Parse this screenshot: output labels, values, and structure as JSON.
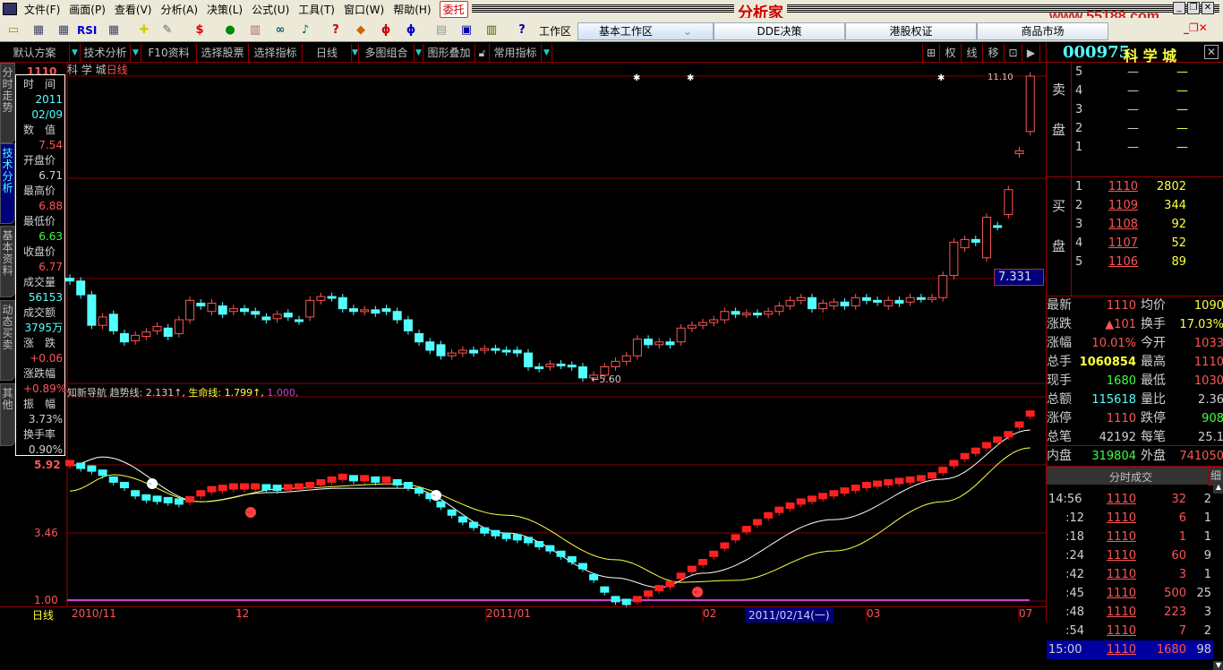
{
  "menu": {
    "items": [
      "文件(F)",
      "画面(P)",
      "查看(V)",
      "分析(A)",
      "决策(L)",
      "公式(U)",
      "工具(T)",
      "窗口(W)",
      "帮助(H)"
    ],
    "entrust": "委托",
    "title": "分析家",
    "logo": "www.55188.com"
  },
  "toolbar": {
    "workspace_label": "工作区",
    "tabs": [
      "基本工作区",
      "DDE决策",
      "港股权证",
      "商品市场"
    ],
    "rsi": "RSI"
  },
  "funcbar": {
    "buttons": [
      "默认方案",
      "技术分析",
      "F10资料",
      "选择股票",
      "选择指标",
      "日线",
      "多图组合",
      "图形叠加",
      "常用指标"
    ],
    "right": [
      "权",
      "线",
      "移"
    ]
  },
  "side_tabs": [
    "分时走势",
    "技术分析",
    "基本资料",
    "动态买卖",
    "其他"
  ],
  "chart_header": {
    "name": "科 学 城",
    "period": "日线",
    "top_price": "1110",
    "max_label": "11.10",
    "min_label": "5.60",
    "current_value": "7.331"
  },
  "info": [
    [
      "时　间",
      "2011"
    ],
    [
      "",
      "02/09"
    ],
    [
      "数　值",
      "7.54"
    ],
    [
      "开盘价",
      "6.71"
    ],
    [
      "最高价",
      "6.88"
    ],
    [
      "最低价",
      "6.63"
    ],
    [
      "收盘价",
      "6.77"
    ],
    [
      "成交量",
      "56153"
    ],
    [
      "成交额",
      "3795万"
    ],
    [
      "涨　跌",
      "+0.06"
    ],
    [
      "涨跌幅",
      "+0.89%"
    ],
    [
      "振　幅",
      "3.73%"
    ],
    [
      "换手率",
      "0.90%"
    ]
  ],
  "indicator": {
    "name": "知新导航",
    "trend_label": "趋势线: 2.131↑,",
    "life_label": "生命线: 1.799↑,",
    "base_label": "1.000,",
    "ticks": [
      "5.92",
      "3.46",
      "1.00"
    ]
  },
  "date_axis": {
    "period": "日线",
    "labels": [
      "2010/11",
      "12",
      "2011/01",
      "02",
      "03",
      "07"
    ],
    "cursor": "2011/02/14(一)"
  },
  "chart_data": {
    "type": "candlestick",
    "price_range": [
      5.6,
      11.1
    ],
    "open": [
      7.45,
      7.4,
      7.15,
      6.6,
      6.8,
      6.45,
      6.32,
      6.4,
      6.5,
      6.55,
      6.45,
      6.7,
      7.0,
      6.85,
      6.95,
      6.85,
      6.9,
      6.85,
      6.75,
      6.72,
      6.82,
      6.7,
      6.75,
      7.05,
      7.12,
      7.1,
      6.9,
      6.85,
      6.88,
      6.9,
      6.85,
      6.7,
      6.45,
      6.3,
      6.25,
      6.05,
      6.1,
      6.15,
      6.15,
      6.18,
      6.15,
      6.15,
      6.1,
      5.85,
      5.85,
      5.9,
      5.88,
      5.85,
      5.65,
      5.7,
      5.85,
      5.95,
      6.05,
      6.35,
      6.25,
      6.3,
      6.3,
      6.55,
      6.6,
      6.65,
      6.7,
      6.85,
      6.8,
      6.82,
      6.8,
      6.85,
      6.95,
      7.05,
      7.1,
      6.9,
      6.95,
      7.02,
      6.95,
      7.1,
      7.05,
      6.95,
      7.05,
      7.02,
      7.1,
      7.08,
      7.1,
      7.5,
      8.0,
      8.15,
      7.82,
      8.4,
      8.6,
      9.7,
      10.1
    ],
    "close": [
      7.4,
      7.15,
      6.6,
      6.75,
      6.5,
      6.3,
      6.42,
      6.48,
      6.58,
      6.4,
      6.7,
      7.05,
      6.95,
      7.0,
      6.8,
      6.9,
      6.85,
      6.8,
      6.7,
      6.8,
      6.75,
      6.68,
      7.05,
      7.12,
      7.1,
      6.9,
      6.85,
      6.88,
      6.82,
      6.85,
      6.7,
      6.5,
      6.3,
      6.15,
      6.05,
      6.1,
      6.15,
      6.1,
      6.18,
      6.15,
      6.12,
      6.1,
      5.85,
      5.82,
      5.9,
      5.88,
      5.85,
      5.65,
      5.7,
      5.85,
      5.95,
      6.05,
      6.35,
      6.25,
      6.3,
      6.25,
      6.55,
      6.6,
      6.65,
      6.7,
      6.85,
      6.8,
      6.82,
      6.8,
      6.85,
      6.95,
      7.05,
      7.1,
      6.9,
      7.0,
      7.02,
      6.95,
      7.1,
      7.05,
      7.02,
      7.05,
      7.0,
      7.1,
      7.08,
      7.1,
      7.5,
      8.1,
      8.15,
      8.1,
      8.55,
      8.38,
      9.05,
      9.75,
      11.1
    ],
    "indicator_values": [
      6.1,
      6.0,
      5.9,
      5.75,
      5.5,
      5.3,
      5.0,
      4.85,
      4.8,
      4.75,
      4.7,
      4.78,
      5.0,
      5.15,
      5.2,
      5.25,
      5.25,
      5.25,
      5.22,
      5.2,
      5.22,
      5.25,
      5.3,
      5.4,
      5.5,
      5.6,
      5.55,
      5.55,
      5.5,
      5.5,
      5.4,
      5.3,
      5.1,
      4.9,
      4.6,
      4.3,
      4.05,
      3.85,
      3.65,
      3.55,
      3.45,
      3.4,
      3.3,
      3.15,
      3.0,
      2.8,
      2.6,
      2.35,
      1.95,
      1.5,
      1.15,
      1.05,
      1.15,
      1.35,
      1.55,
      1.7,
      2.0,
      2.25,
      2.5,
      2.8,
      3.1,
      3.4,
      3.7,
      3.95,
      4.2,
      4.4,
      4.55,
      4.7,
      4.8,
      4.9,
      5.0,
      5.1,
      5.2,
      5.3,
      5.35,
      5.4,
      5.45,
      5.5,
      5.55,
      5.65,
      5.85,
      6.1,
      6.35,
      6.55,
      6.75,
      6.95,
      7.15,
      7.5,
      7.9
    ],
    "trend_line": [
      [
        0,
        5.89
      ],
      [
        3,
        6.21
      ],
      [
        12,
        4.58
      ],
      [
        18,
        4.91
      ],
      [
        25,
        5.07
      ],
      [
        31,
        5.07
      ],
      [
        40,
        3.44
      ],
      [
        50,
        1.81
      ],
      [
        54,
        1.46
      ],
      [
        58,
        1.98
      ],
      [
        70,
        3.93
      ],
      [
        80,
        5.4
      ],
      [
        88,
        7.19
      ]
    ],
    "life_line": [
      [
        0,
        4.97
      ],
      [
        4,
        5.56
      ],
      [
        12,
        4.58
      ],
      [
        20,
        5.07
      ],
      [
        30,
        5.23
      ],
      [
        40,
        4.09
      ],
      [
        50,
        2.47
      ],
      [
        56,
        1.65
      ],
      [
        61,
        1.72
      ],
      [
        70,
        2.79
      ],
      [
        80,
        4.58
      ],
      [
        88,
        6.54
      ]
    ],
    "base_line": 1.0,
    "indicator_range": [
      1.0,
      5.92
    ]
  },
  "right": {
    "code": "000975",
    "name": "科 学 城",
    "sell_label": [
      "卖",
      "盘"
    ],
    "buy_label": [
      "买",
      "盘"
    ],
    "sell": [
      [
        "5",
        "—",
        "—"
      ],
      [
        "4",
        "—",
        "—"
      ],
      [
        "3",
        "—",
        "—"
      ],
      [
        "2",
        "—",
        "—"
      ],
      [
        "1",
        "—",
        "—"
      ]
    ],
    "buy": [
      [
        "1",
        "1110",
        "2802"
      ],
      [
        "2",
        "1109",
        "344"
      ],
      [
        "3",
        "1108",
        "92"
      ],
      [
        "4",
        "1107",
        "52"
      ],
      [
        "5",
        "1106",
        "89"
      ]
    ],
    "stats": [
      [
        "最新",
        "1110",
        "均价",
        "1090"
      ],
      [
        "涨跌",
        "▲101",
        "换手",
        "17.03%"
      ],
      [
        "涨幅",
        "10.01%",
        "今开",
        "1033"
      ],
      [
        "总手",
        "1060854",
        "最高",
        "1110"
      ],
      [
        "现手",
        "1680",
        "最低",
        "1030"
      ],
      [
        "总额",
        "115618",
        "量比",
        "2.36"
      ],
      [
        "涨停",
        "1110",
        "跌停",
        "908"
      ],
      [
        "总笔",
        "42192",
        "每笔",
        "25.1"
      ],
      [
        "内盘",
        "319804",
        "外盘",
        "741050"
      ]
    ],
    "ticks_title": "分时成交",
    "ticks_detail": "细",
    "ticks": [
      [
        "14:56",
        "1110",
        "32",
        "2"
      ],
      [
        ":12",
        "1110",
        "6",
        "1"
      ],
      [
        ":18",
        "1110",
        "1",
        "1"
      ],
      [
        ":24",
        "1110",
        "60",
        "9"
      ],
      [
        ":42",
        "1110",
        "3",
        "1"
      ],
      [
        ":45",
        "1110",
        "500",
        "25"
      ],
      [
        ":48",
        "1110",
        "223",
        "3"
      ],
      [
        ":54",
        "1110",
        "7",
        "2"
      ],
      [
        "15:00",
        "1110",
        "1680",
        "98"
      ]
    ]
  }
}
